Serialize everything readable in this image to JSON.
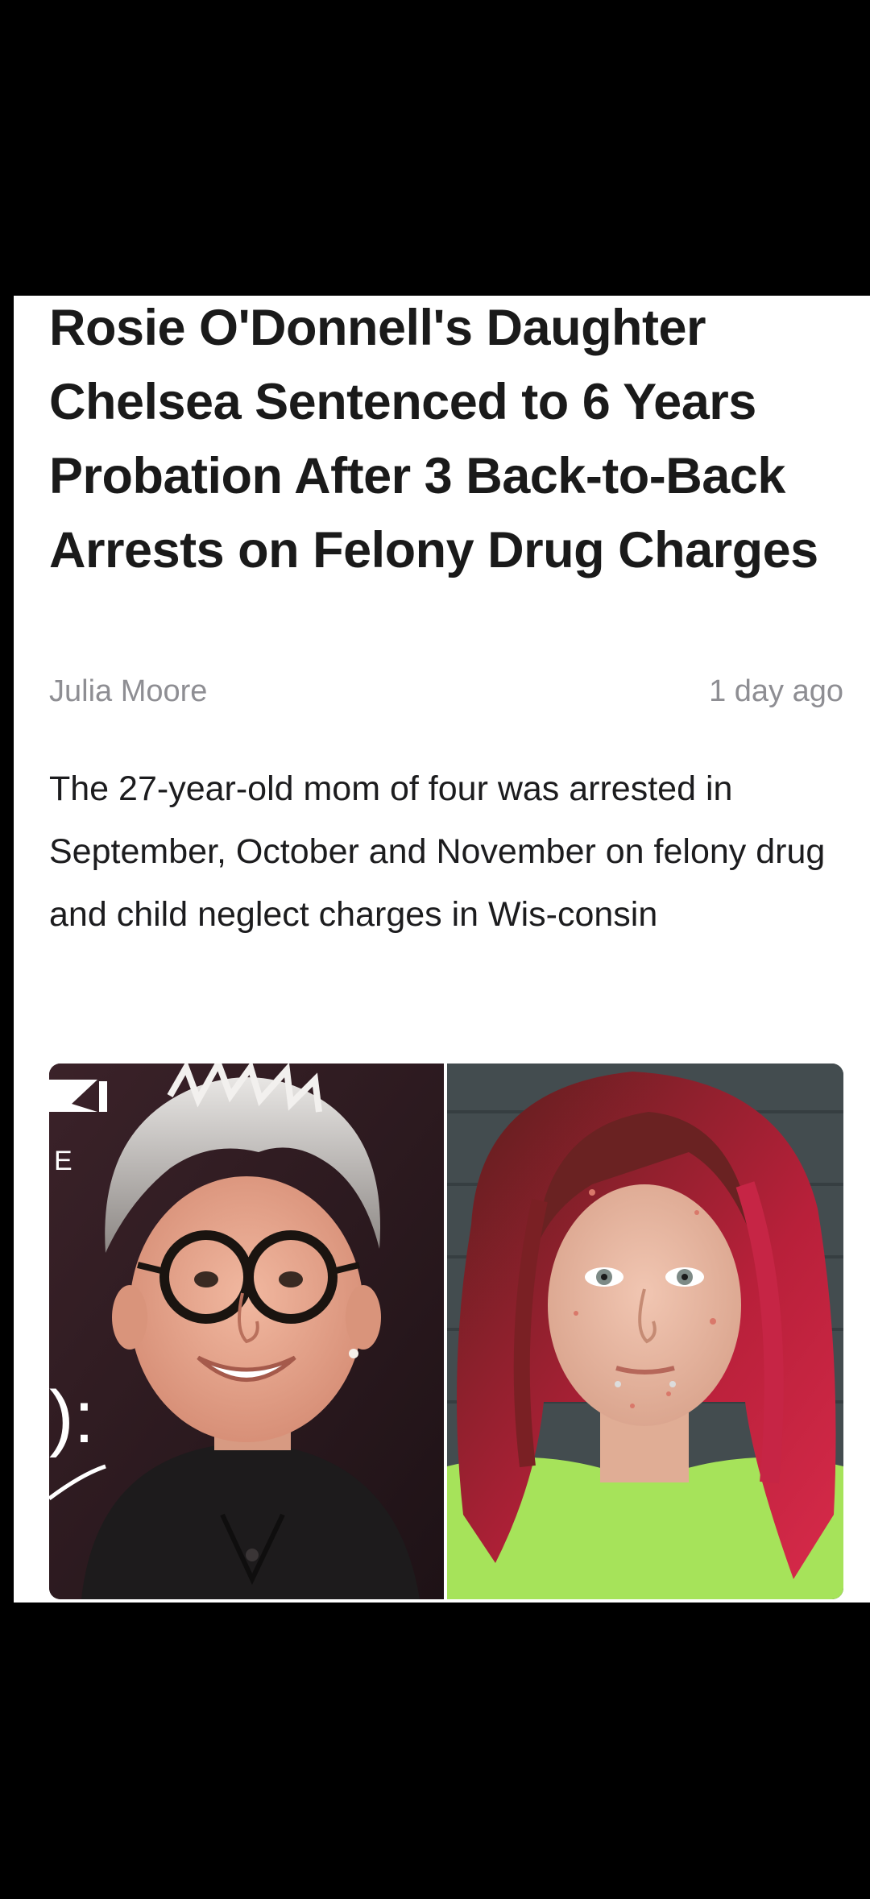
{
  "article": {
    "headline": "Rosie O'Donnell's Daughter Chelsea Sentenced to 6 Years Probation After 3 Back-to-Back Arrests on Felony Drug Charges",
    "author": "Julia Moore",
    "timestamp": "1 day ago",
    "lede": "The 27-year-old mom of four was arrested in September, October and November on felony drug and child neglect charges in Wis-consin"
  },
  "photos": {
    "left_backdrop_text": "E",
    "left_backdrop_text_2": "):"
  },
  "colors": {
    "background": "#000000",
    "card": "#ffffff",
    "headline": "#1a1a1a",
    "meta": "#8e8e93",
    "body": "#1c1c1e"
  }
}
